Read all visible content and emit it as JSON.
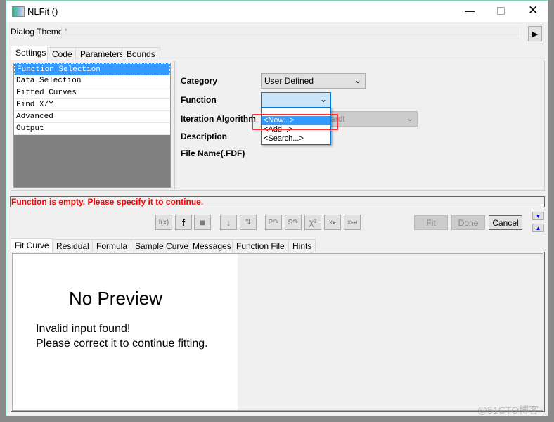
{
  "window": {
    "title": "NLFit ()"
  },
  "theme": {
    "label": "Dialog Theme",
    "value": "*"
  },
  "top_tabs": [
    "Settings",
    "Code",
    "Parameters",
    "Bounds"
  ],
  "nav_items": [
    "Function Selection",
    "Data Selection",
    "Fitted Curves",
    "Find X/Y",
    "Advanced",
    "Output"
  ],
  "form": {
    "category_label": "Category",
    "category_value": "User Defined",
    "function_label": "Function",
    "function_value": "",
    "iteration_label": "Iteration Algorithm",
    "iteration_value": "Levenberg Marquardt",
    "description_label": "Description",
    "filename_label": "File Name(.FDF)"
  },
  "dropdown_options": [
    "<New...>",
    "<Add...>",
    "<Search...>"
  ],
  "status": {
    "message": "Function is empty. Please specify it to continue.",
    "color": "#ff0000"
  },
  "toolbar": {
    "fit": "Fit",
    "done": "Done",
    "cancel": "Cancel"
  },
  "toolbar_icons": [
    "f(x)-icon",
    "fdf-file-icon",
    "save-icon",
    "sort-icon",
    "parameter-init-icon",
    "p-undo-icon",
    "s-undo-icon",
    "chi-square-icon",
    "one-iteration-icon",
    "fit-until-converged-icon"
  ],
  "bottom_tabs": [
    "Fit Curve",
    "Residual",
    "Formula",
    "Sample Curve",
    "Messages",
    "Function File",
    "Hints"
  ],
  "preview": {
    "title": "No Preview",
    "line1": "Invalid input found!",
    "line2": "Please correct it to continue fitting."
  },
  "watermark": "@51CTO博客"
}
